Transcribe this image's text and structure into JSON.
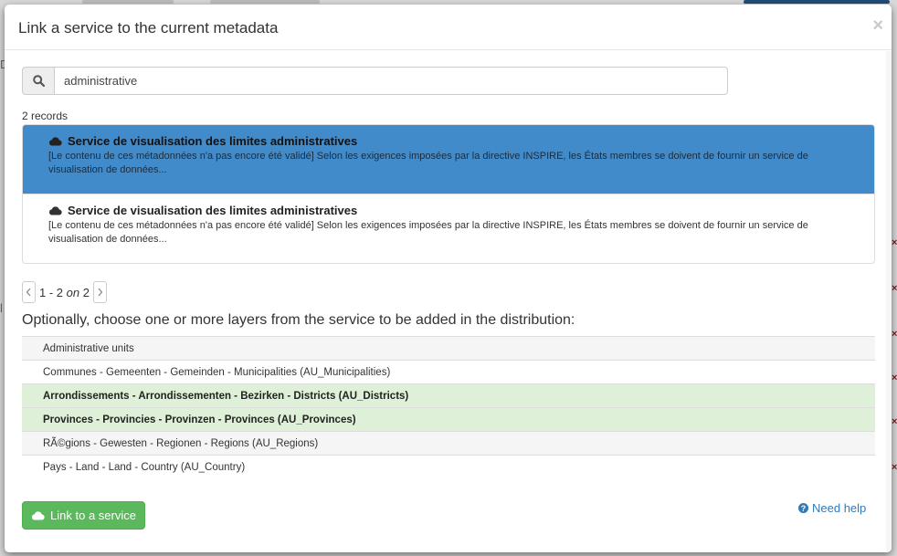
{
  "modal": {
    "title": "Link a service to the current metadata",
    "close_label": "×"
  },
  "search": {
    "value": "administrative",
    "icon": "search-icon"
  },
  "records": {
    "count_label": "2 records",
    "items": [
      {
        "icon": "cloud-icon",
        "title": "Service de visualisation des limites administratives",
        "description": "[Le contenu de ces métadonnées n'a pas encore été validé] Selon les exigences imposées par la directive INSPIRE, les États membres se doivent de fournir un service de visualisation de données...",
        "selected": true
      },
      {
        "icon": "cloud-icon",
        "title": "Service de visualisation des limites administratives",
        "description": "[Le contenu de ces métadonnées n'a pas encore été validé] Selon les exigences imposées par la directive INSPIRE, les États membres se doivent de fournir un service de visualisation de données...",
        "selected": false
      }
    ]
  },
  "pagination": {
    "range": "1 - 2",
    "on": "on",
    "total": "2"
  },
  "layers": {
    "heading": "Optionally, choose one or more layers from the service to be added in the distribution:",
    "rows": [
      {
        "label": "Administrative units",
        "selected": false
      },
      {
        "label": "Communes - Gemeenten - Gemeinden - Municipalities (AU_Municipalities)",
        "selected": false
      },
      {
        "label": "Arrondissements - Arrondissementen - Bezirken - Districts (AU_Districts)",
        "selected": true
      },
      {
        "label": "Provinces - Provincies - Provinzen - Provinces (AU_Provinces)",
        "selected": true
      },
      {
        "label": "RÃ©gions - Gewesten - Regionen - Regions (AU_Regions)",
        "selected": false
      },
      {
        "label": "Pays - Land - Land - Country (AU_Country)",
        "selected": false
      }
    ]
  },
  "footer": {
    "link_button": "Link to a service",
    "help_link": "Need help"
  },
  "colors": {
    "selected_record": "#428bca",
    "selected_layer": "#dff0d8",
    "primary_button": "#5cb85c",
    "link": "#337ab7"
  }
}
